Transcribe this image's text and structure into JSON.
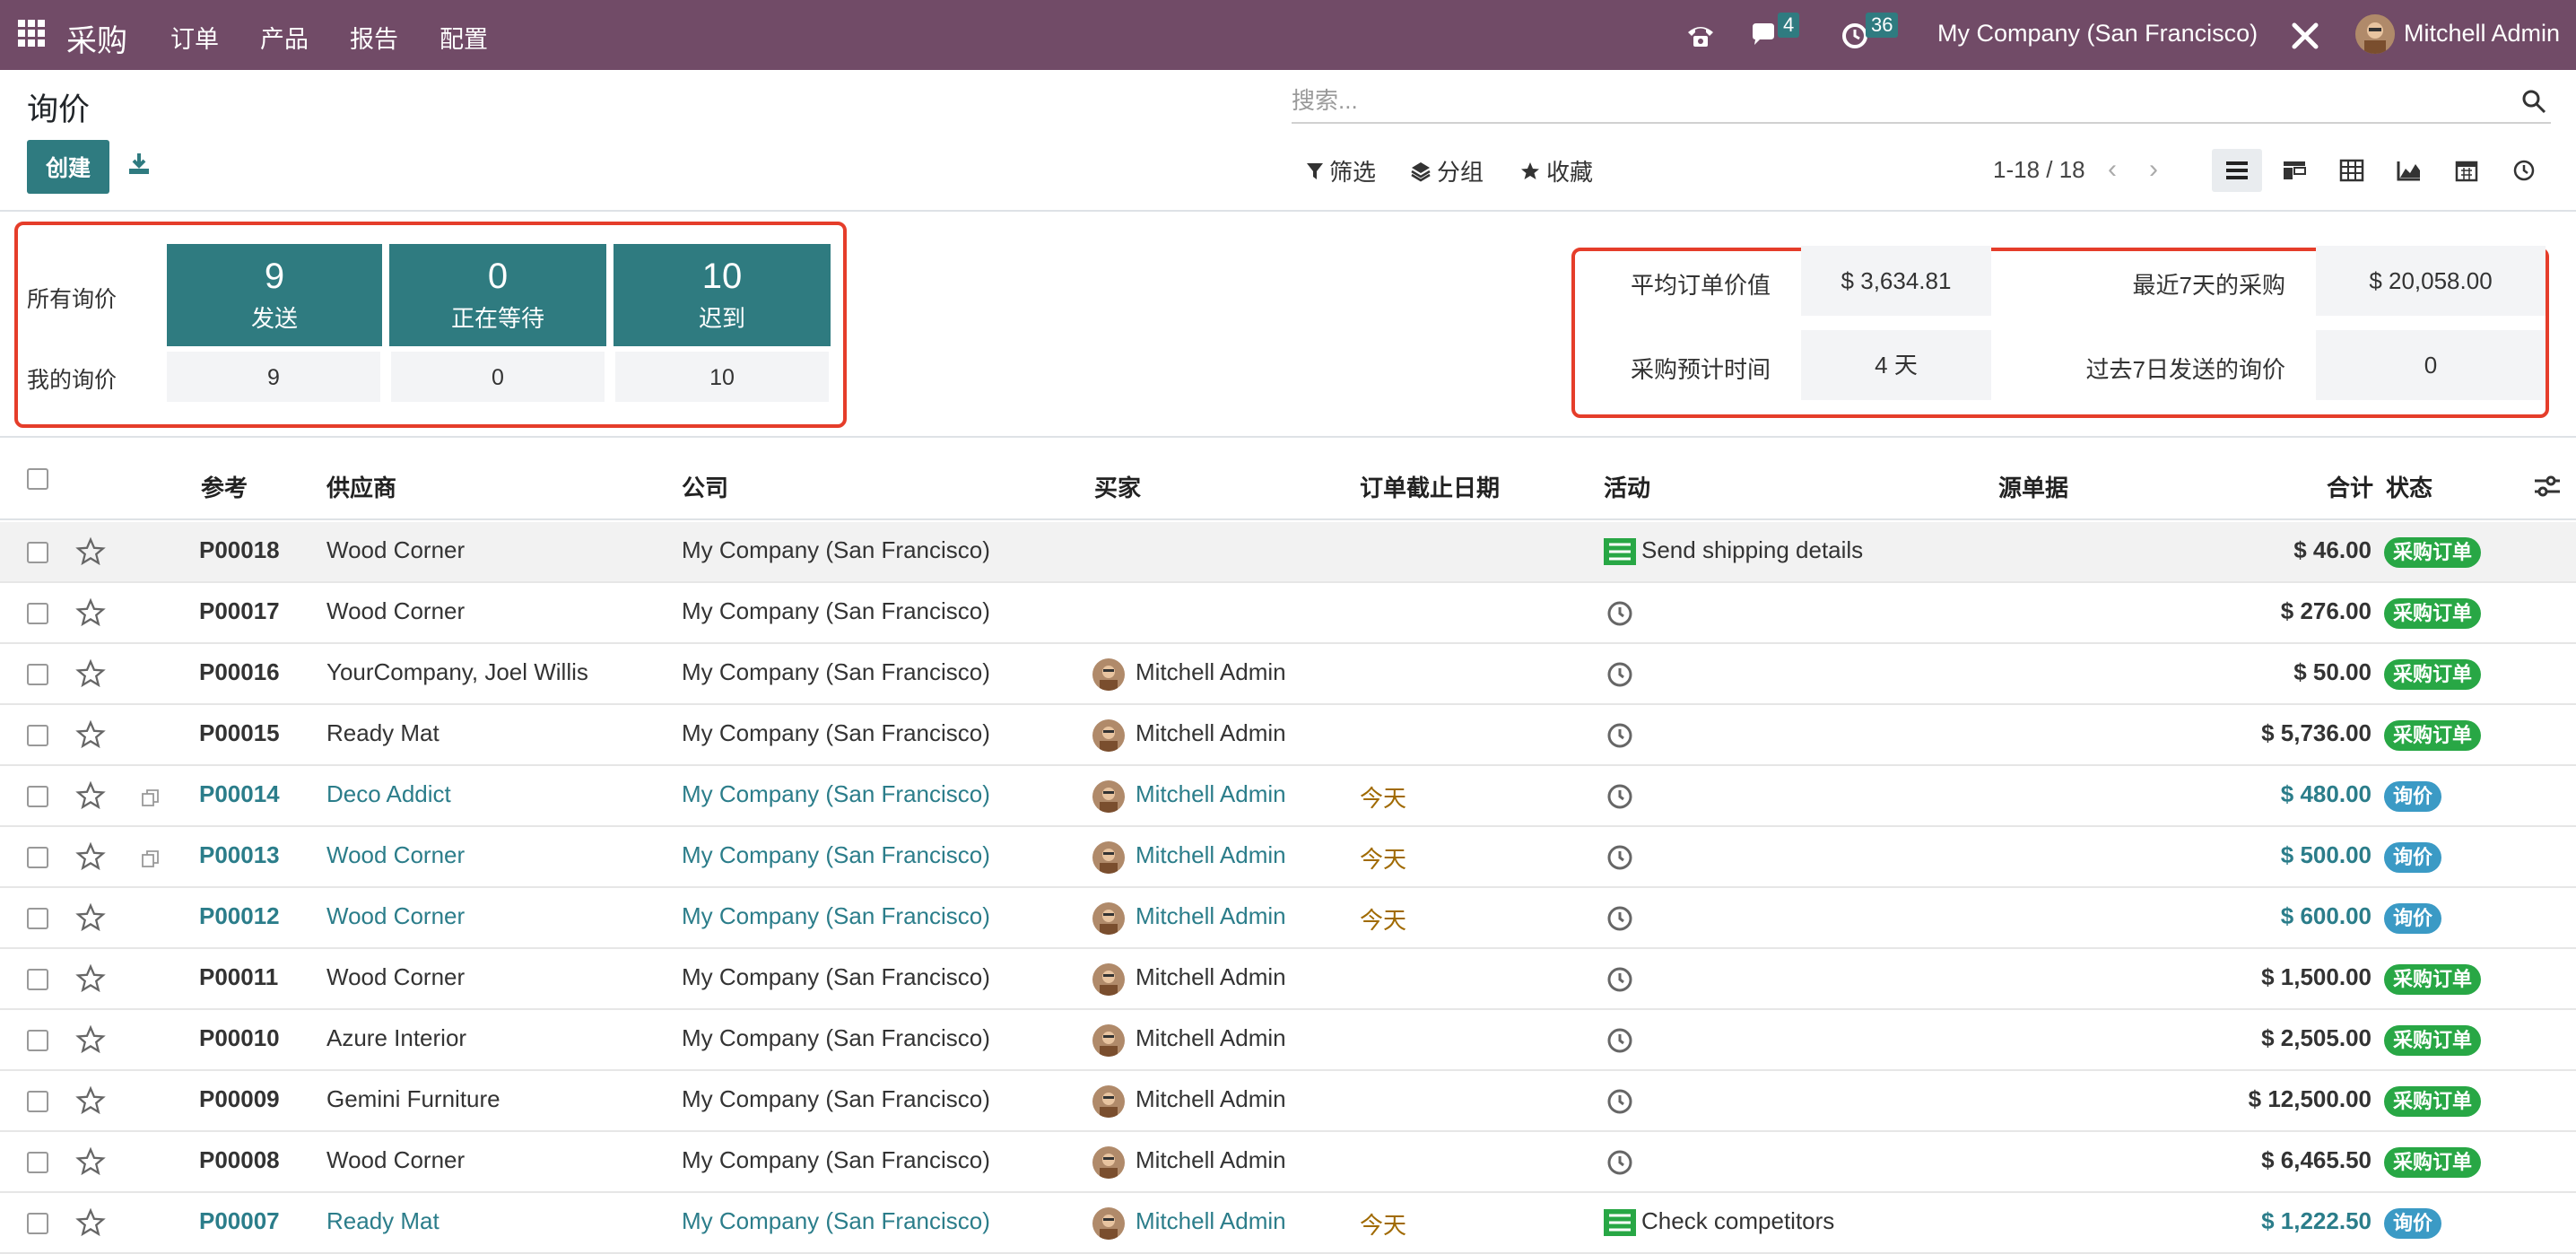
{
  "navbar": {
    "app_name": "采购",
    "menu": [
      "订单",
      "产品",
      "报告",
      "配置"
    ],
    "chat_count": "4",
    "activity_count": "36",
    "company": "My Company (San Francisco)",
    "user": "Mitchell Admin"
  },
  "page": {
    "title": "询价",
    "create_label": "创建",
    "search_placeholder": "搜索...",
    "filter_label": "筛选",
    "group_label": "分组",
    "favorites_label": "收藏",
    "pager": "1-18 / 18"
  },
  "dashboard": {
    "all_rfqs_label": "所有询价",
    "my_rfqs_label": "我的询价",
    "tiles": [
      {
        "count": "9",
        "caption": "发送",
        "mine": "9"
      },
      {
        "count": "0",
        "caption": "正在等待",
        "mine": "0"
      },
      {
        "count": "10",
        "caption": "迟到",
        "mine": "10"
      }
    ],
    "stats": {
      "avg_order_value_label": "平均订单价值",
      "avg_order_value": "$ 3,634.81",
      "last7_purchase_label": "最近7天的采购",
      "last7_purchase": "$ 20,058.00",
      "lead_time_label": "采购预计时间",
      "lead_time": "4 天",
      "rfq_sent_label": "过去7日发送的询价",
      "rfq_sent": "0"
    }
  },
  "table": {
    "headers": {
      "reference": "参考",
      "vendor": "供应商",
      "company": "公司",
      "buyer": "买家",
      "deadline": "订单截止日期",
      "activity": "活动",
      "source": "源单据",
      "total": "合计",
      "status": "状态"
    },
    "rows": [
      {
        "ref": "P00018",
        "vendor": "Wood Corner",
        "company": "My Company (San Francisco)",
        "buyer": "",
        "deadline": "",
        "activity": "Send shipping details",
        "activity_icon": "list-icon",
        "total": "$ 46.00",
        "status": "采购订单",
        "kind": "po",
        "link": false,
        "copy_icon": false
      },
      {
        "ref": "P00017",
        "vendor": "Wood Corner",
        "company": "My Company (San Francisco)",
        "buyer": "",
        "deadline": "",
        "activity": "",
        "activity_icon": "clock-icon",
        "total": "$ 276.00",
        "status": "采购订单",
        "kind": "po",
        "link": false,
        "copy_icon": false
      },
      {
        "ref": "P00016",
        "vendor": "YourCompany, Joel Willis",
        "company": "My Company (San Francisco)",
        "buyer": "Mitchell Admin",
        "deadline": "",
        "activity": "",
        "activity_icon": "clock-icon",
        "total": "$ 50.00",
        "status": "采购订单",
        "kind": "po",
        "link": false,
        "copy_icon": false
      },
      {
        "ref": "P00015",
        "vendor": "Ready Mat",
        "company": "My Company (San Francisco)",
        "buyer": "Mitchell Admin",
        "deadline": "",
        "activity": "",
        "activity_icon": "clock-icon",
        "total": "$ 5,736.00",
        "status": "采购订单",
        "kind": "po",
        "link": false,
        "copy_icon": false
      },
      {
        "ref": "P00014",
        "vendor": "Deco Addict",
        "company": "My Company (San Francisco)",
        "buyer": "Mitchell Admin",
        "deadline": "今天",
        "activity": "",
        "activity_icon": "clock-icon",
        "total": "$ 480.00",
        "status": "询价",
        "kind": "rfq",
        "link": true,
        "copy_icon": true
      },
      {
        "ref": "P00013",
        "vendor": "Wood Corner",
        "company": "My Company (San Francisco)",
        "buyer": "Mitchell Admin",
        "deadline": "今天",
        "activity": "",
        "activity_icon": "clock-icon",
        "total": "$ 500.00",
        "status": "询价",
        "kind": "rfq",
        "link": true,
        "copy_icon": true
      },
      {
        "ref": "P00012",
        "vendor": "Wood Corner",
        "company": "My Company (San Francisco)",
        "buyer": "Mitchell Admin",
        "deadline": "今天",
        "activity": "",
        "activity_icon": "clock-icon",
        "total": "$ 600.00",
        "status": "询价",
        "kind": "rfq",
        "link": true,
        "copy_icon": false
      },
      {
        "ref": "P00011",
        "vendor": "Wood Corner",
        "company": "My Company (San Francisco)",
        "buyer": "Mitchell Admin",
        "deadline": "",
        "activity": "",
        "activity_icon": "clock-icon",
        "total": "$ 1,500.00",
        "status": "采购订单",
        "kind": "po",
        "link": false,
        "copy_icon": false
      },
      {
        "ref": "P00010",
        "vendor": "Azure Interior",
        "company": "My Company (San Francisco)",
        "buyer": "Mitchell Admin",
        "deadline": "",
        "activity": "",
        "activity_icon": "clock-icon",
        "total": "$ 2,505.00",
        "status": "采购订单",
        "kind": "po",
        "link": false,
        "copy_icon": false
      },
      {
        "ref": "P00009",
        "vendor": "Gemini Furniture",
        "company": "My Company (San Francisco)",
        "buyer": "Mitchell Admin",
        "deadline": "",
        "activity": "",
        "activity_icon": "clock-icon",
        "total": "$ 12,500.00",
        "status": "采购订单",
        "kind": "po",
        "link": false,
        "copy_icon": false
      },
      {
        "ref": "P00008",
        "vendor": "Wood Corner",
        "company": "My Company (San Francisco)",
        "buyer": "Mitchell Admin",
        "deadline": "",
        "activity": "",
        "activity_icon": "clock-icon",
        "total": "$ 6,465.50",
        "status": "采购订单",
        "kind": "po",
        "link": false,
        "copy_icon": false
      },
      {
        "ref": "P00007",
        "vendor": "Ready Mat",
        "company": "My Company (San Francisco)",
        "buyer": "Mitchell Admin",
        "deadline": "今天",
        "activity": "Check competitors",
        "activity_icon": "list-icon",
        "total": "$ 1,222.50",
        "status": "询价",
        "kind": "rfq",
        "link": true,
        "copy_icon": false
      }
    ]
  },
  "colors": {
    "navbar": "#714B67",
    "primary": "#2f7b80",
    "link": "#2b7d8a",
    "status_po": "#28a745",
    "status_rfq": "#3b9ac5",
    "highlight_box": "#e53d2a"
  }
}
